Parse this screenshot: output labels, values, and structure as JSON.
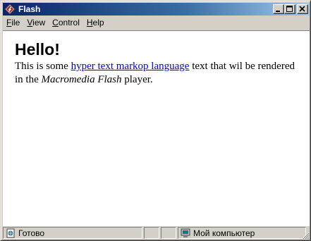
{
  "window": {
    "title": "Flash"
  },
  "menu": {
    "items": [
      {
        "accel": "F",
        "rest": "ile"
      },
      {
        "accel": "V",
        "rest": "iew"
      },
      {
        "accel": "C",
        "rest": "ontrol"
      },
      {
        "accel": "H",
        "rest": "elp"
      }
    ]
  },
  "content": {
    "heading": "Hello!",
    "text_before_link": "This is some ",
    "link": "hyper text markop language",
    "text_after_link": " text that wil be rendered in the ",
    "italic": "Macromedia Flash",
    "text_end": " player."
  },
  "status": {
    "ready_text": "Готово",
    "zone_text": "Мой компьютер"
  },
  "icons": {
    "app": "flash-app-icon",
    "status_page": "page-icon",
    "zone": "my-computer-icon"
  },
  "colors": {
    "title_start": "#0a246a",
    "title_end": "#a6caf0",
    "chrome": "#d4d0c8",
    "link": "#0000ee"
  }
}
